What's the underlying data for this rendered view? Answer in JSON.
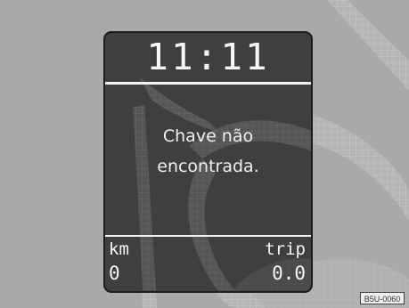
{
  "cluster": {
    "time": "11:11",
    "message_line_1": "Chave não",
    "message_line_2": "encontrada.",
    "km_label": "km",
    "km_value": "0",
    "trip_label": "trip",
    "trip_value": "0.0"
  },
  "figure_code": "B5U-0060",
  "watermark_icon": "b-letter-watermark-icon",
  "colors": {
    "background": "#a9a9a9",
    "display": "#3f3f3f",
    "text": "#f7f7f7"
  }
}
